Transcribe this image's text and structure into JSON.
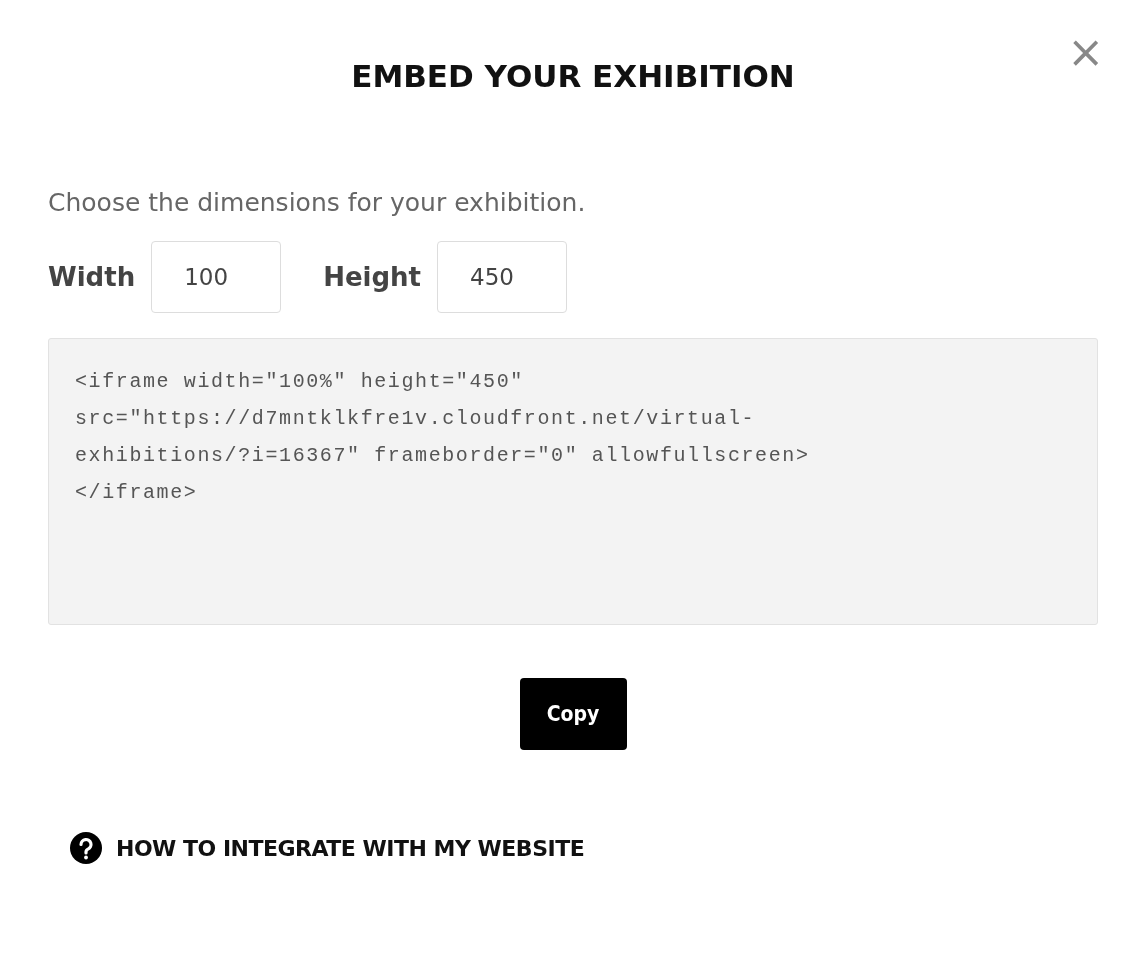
{
  "dialog": {
    "title": "EMBED YOUR EXHIBITION",
    "close": "×"
  },
  "description": "Choose the dimensions for your exhibition.",
  "fields": [
    {
      "label": "Width",
      "value": "100"
    },
    {
      "label": "Height",
      "value": "450"
    }
  ],
  "code_lines": [
    "<iframe width=\"100%\" height=\"450\"",
    "src=\"https://d7mntklkfre1v.cloudfront.net/virtual-",
    "exhibitions/?i=16367\" frameborder=\"0\" allowfullscreen>",
    "</iframe>"
  ],
  "copy_button": "Copy",
  "help_link": "HOW TO INTEGRATE WITH MY WEBSITE"
}
